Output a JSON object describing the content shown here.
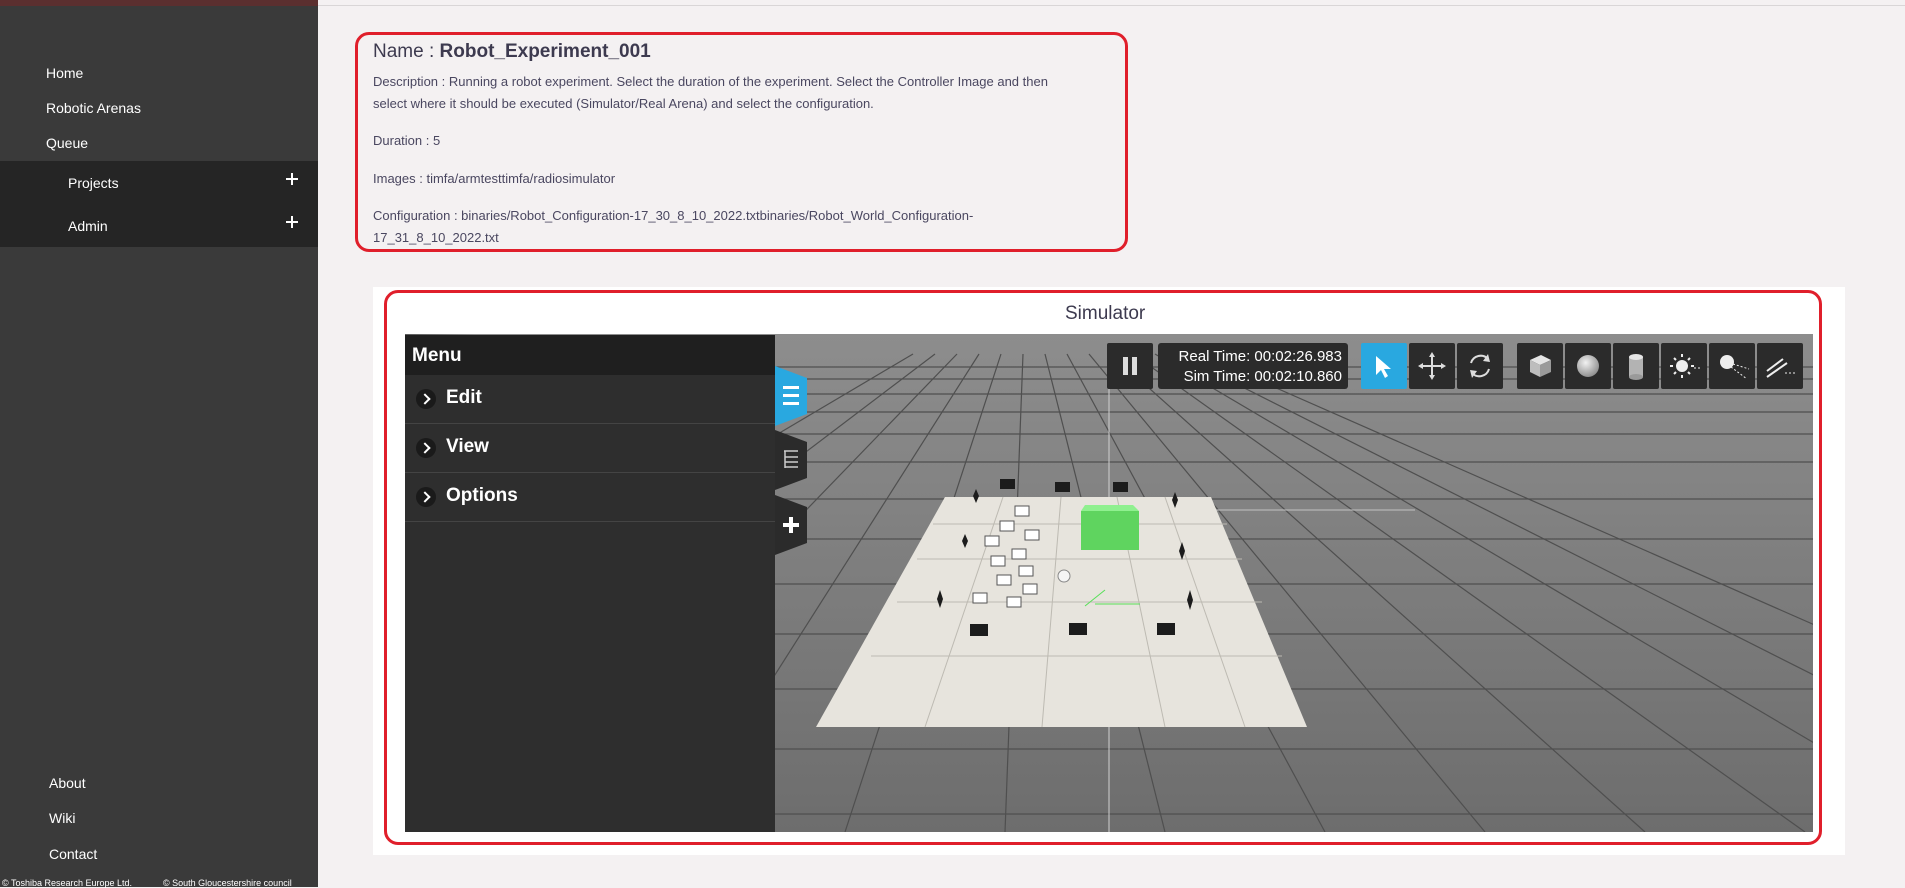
{
  "sidebar": {
    "nav": [
      "Home",
      "Robotic Arenas",
      "Queue"
    ],
    "sub": [
      "Projects",
      "Admin"
    ],
    "footer": [
      "About",
      "Wiki",
      "Contact"
    ],
    "copyright": [
      "© Toshiba Research Europe Ltd.",
      "© South Gloucestershire council"
    ]
  },
  "experiment": {
    "name_label": "Name : ",
    "name": "Robot_Experiment_001",
    "description_line1": "Description : Running a robot experiment. Select the duration of the experiment. Select the Controller Image and then",
    "description_line2": "select where it should be executed (Simulator/Real Arena) and select the configuration.",
    "duration": "Duration : 5",
    "images": "Images : timfa/armtesttimfa/radiosimulator",
    "configuration_line1": "Configuration : binaries/Robot_Configuration-17_30_8_10_2022.txtbinaries/Robot_World_Configuration-",
    "configuration_line2": "17_31_8_10_2022.txt"
  },
  "simulator": {
    "title": "Simulator",
    "menu_title": "Menu",
    "menu_items": [
      "Edit",
      "View",
      "Options"
    ],
    "real_time": "Real Time: 00:02:26.983",
    "sim_time": "Sim Time: 00:02:10.860",
    "accent_color": "#29a8e0",
    "tabs": [
      "hamburger-icon",
      "tree-icon",
      "plus-icon"
    ],
    "toolbar": [
      "pause-icon",
      "select-arrow-icon",
      "translate-icon",
      "rotate-icon",
      "box-icon",
      "sphere-icon",
      "cylinder-icon",
      "point-light-icon",
      "spot-light-icon",
      "directional-light-icon"
    ]
  }
}
